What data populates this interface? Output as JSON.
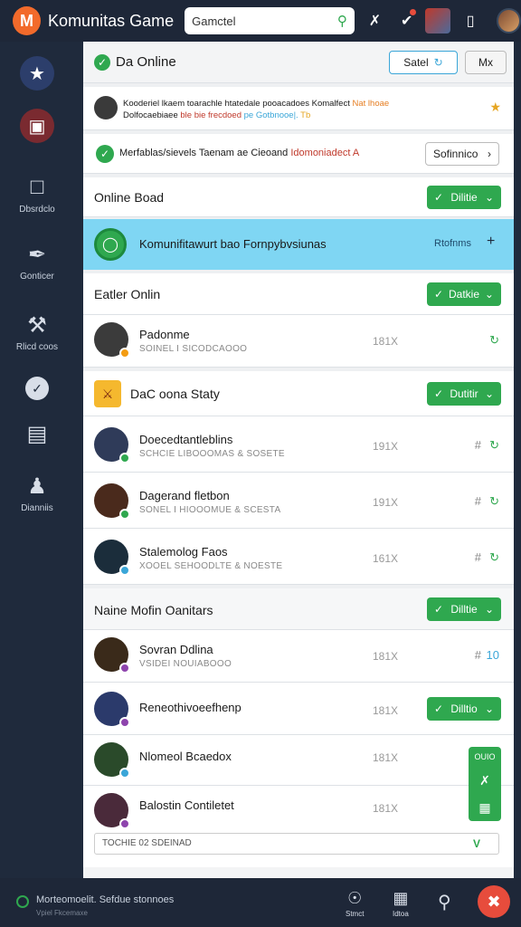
{
  "app": {
    "title": "Komunitas Game",
    "logo_letter": "M"
  },
  "search": {
    "value": "Gamctel",
    "placeholder": "Gamctel"
  },
  "sidebar": {
    "items": [
      {
        "label": "",
        "icon": "star-icon"
      },
      {
        "label": "",
        "icon": "archive-icon"
      },
      {
        "label": "Dbsrdclo",
        "icon": "square-icon"
      },
      {
        "label": "Gonticer",
        "icon": "feather-icon"
      },
      {
        "label": "Rlicd coos",
        "icon": "wrench-icon"
      },
      {
        "label": "",
        "icon": "check-circle-icon"
      },
      {
        "label": "",
        "icon": "list-icon"
      },
      {
        "label": "Dianniis",
        "icon": "group-icon"
      }
    ]
  },
  "header": {
    "title": "Da Online",
    "select_label": "Satel",
    "max_label": "Mx"
  },
  "notice": {
    "line1": "Kooderiel lkaem toarachle htatedale pooacadoes Komalfect",
    "line1_accent": "Nat lhoae",
    "line2": "Dolfocaebiaee",
    "line2_accent": "ble bie frecdoed",
    "line2_tail": "pe Gotbnooe|.",
    "line2_end": "Tb"
  },
  "status": {
    "text": "Merfablas/sievels Taenam ae Cieoand",
    "accent": "Idomoniadect A",
    "button": "Sofinnico"
  },
  "online_board": {
    "title": "Online Boad",
    "button": "Dilitie"
  },
  "banner": {
    "text": "Komunifitawurt bao Fornpybvsiunas",
    "action": "Rtofnms",
    "plus": "+"
  },
  "sections": [
    {
      "title": "Eatler Onlin",
      "button": "Datkie",
      "rows": [
        {
          "name": "Padonme",
          "sub": "SOINEL I SICODCAOOO",
          "stat": "181X",
          "dot": "#f39c12",
          "avatar": "#3b3b3b"
        }
      ]
    },
    {
      "title": "DaC oona Staty",
      "button": "Dutitir",
      "rows": [
        {
          "name": "Doecedtantleblins",
          "sub": "SCHCIE LIBOOOMAS & SOSETE",
          "stat": "191X",
          "dot": "#2fa84f",
          "avatar": "#2f3b59"
        },
        {
          "name": "Dagerand fletbon",
          "sub": "SONEL I HIOOOMUE & SCESTA",
          "stat": "191X",
          "dot": "#2fa84f",
          "avatar": "#4a2a1c"
        },
        {
          "name": "Stalemolog Faos",
          "sub": "XOOEL SEHOODLTE & NOESTE",
          "stat": "161X",
          "dot": "#3aa6d8",
          "avatar": "#1b2d3b"
        }
      ]
    },
    {
      "title": "Naine Mofin Oanitars",
      "button": "Dilltie",
      "rows": [
        {
          "name": "Sovran Ddlina",
          "sub": "VSIDEI NOUIABOOO",
          "stat": "181X",
          "dot": "#8e44ad",
          "avatar": "#3a2a1a",
          "tag": "10"
        },
        {
          "name": "Reneothivoeefhenp",
          "sub": "",
          "stat": "181X",
          "dot": "#8e44ad",
          "avatar": "#2b3a6b",
          "button": "Dilltio"
        },
        {
          "name": "Nlomeol Bcaedox",
          "sub": "",
          "stat": "181X",
          "dot": "#3aa6d8",
          "avatar": "#2a4a2a"
        },
        {
          "name": "Balostin Contiletet",
          "sub": "",
          "stat": "181X",
          "dot": "#8e44ad",
          "avatar": "#4a2a3a"
        }
      ]
    }
  ],
  "footer_row": {
    "text": "TOCHIE 02 SDEINAD",
    "chevron": "V"
  },
  "float_tools": {
    "label": "OUIO"
  },
  "bottombar": {
    "text": "Morteomoelit. Sefdue stonnoes",
    "sub": "Vpiel Fkcemaxe",
    "icons": [
      {
        "label": "Stmct"
      },
      {
        "label": "Idtoa"
      }
    ]
  },
  "colors": {
    "accent": "#2fa84f",
    "brand": "#f26a2b",
    "banner": "#7fd6f3",
    "dark": "#1e2738"
  }
}
